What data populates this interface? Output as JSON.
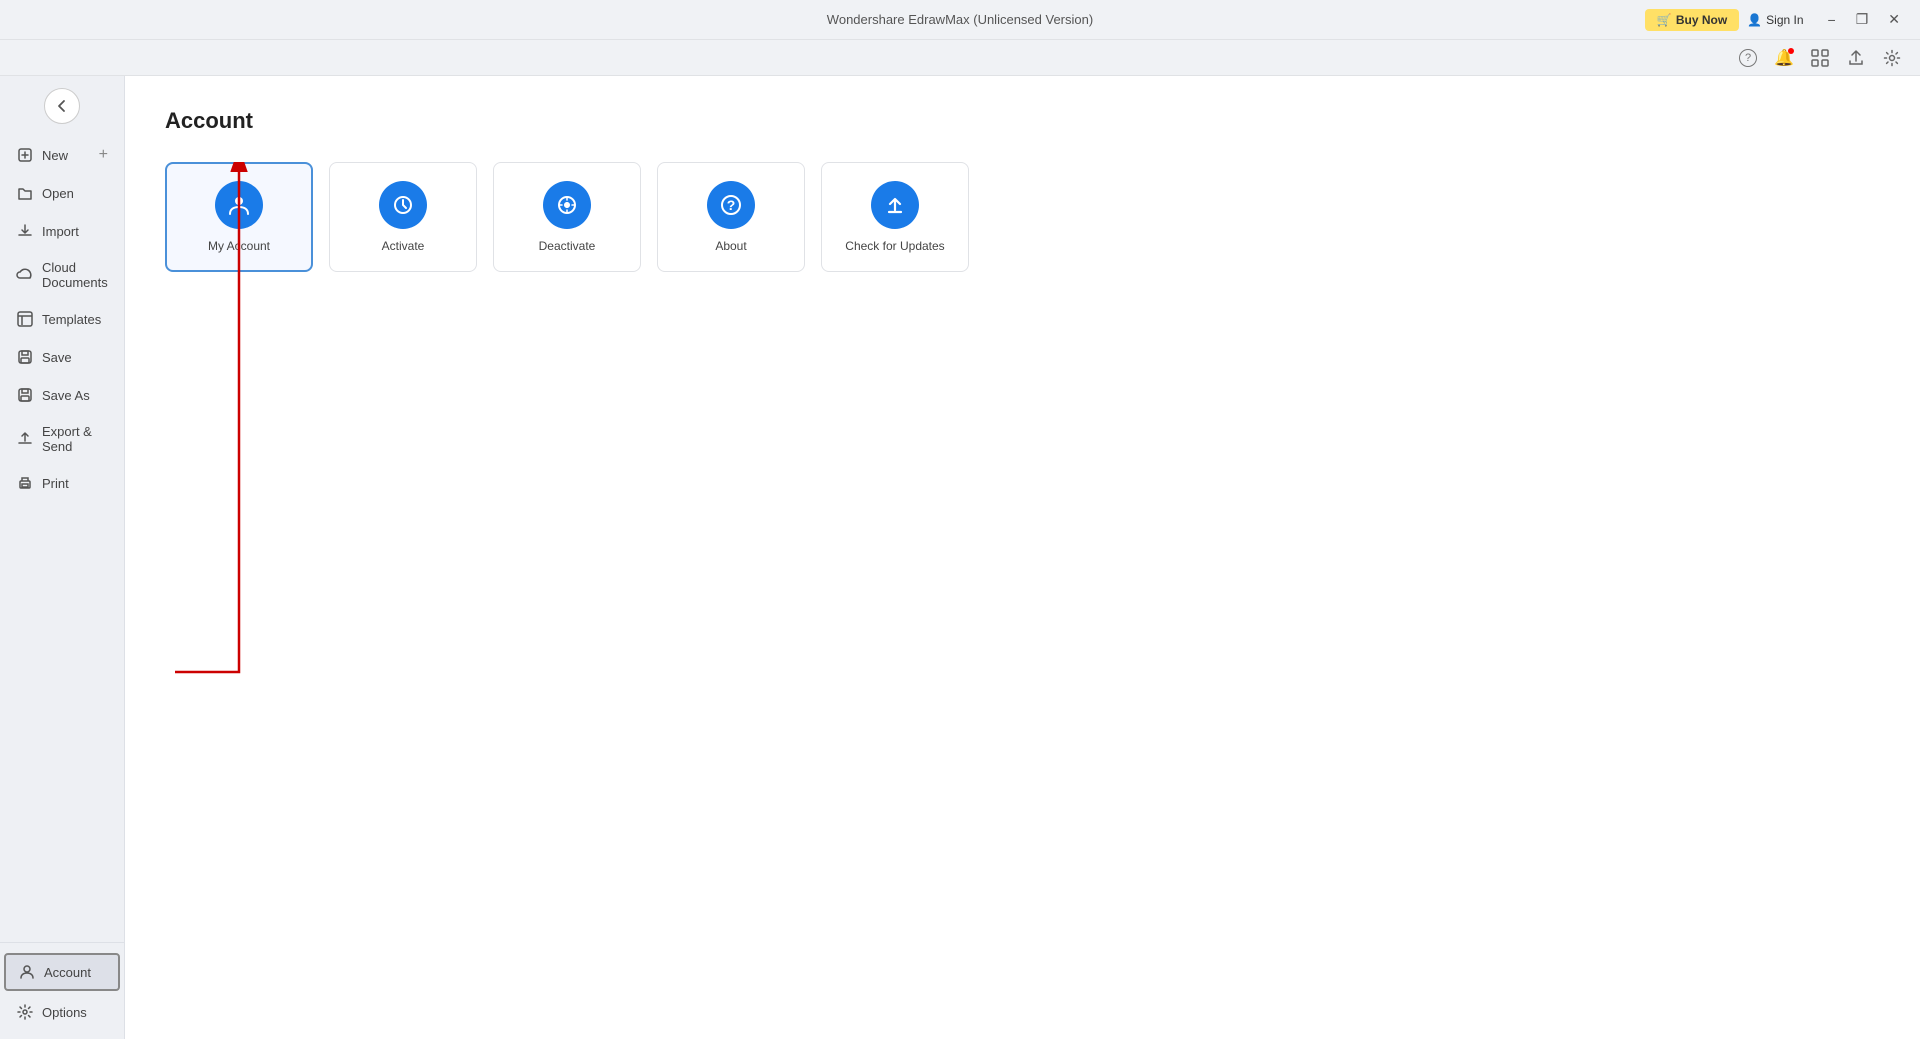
{
  "titlebar": {
    "title": "Wondershare EdrawMax (Unlicensed Version)",
    "buy_now": "Buy Now",
    "sign_in": "Sign In",
    "minimize": "−",
    "restore": "❐",
    "close": "✕"
  },
  "sidebar": {
    "new_label": "New",
    "new_plus": "+",
    "items": [
      {
        "id": "open",
        "label": "Open",
        "icon": "📂"
      },
      {
        "id": "import",
        "label": "Import",
        "icon": "📥"
      },
      {
        "id": "cloud",
        "label": "Cloud Documents",
        "icon": "☁"
      },
      {
        "id": "templates",
        "label": "Templates",
        "icon": "📄"
      },
      {
        "id": "save",
        "label": "Save",
        "icon": "💾"
      },
      {
        "id": "saveas",
        "label": "Save As",
        "icon": "💾"
      },
      {
        "id": "export",
        "label": "Export & Send",
        "icon": "📤"
      },
      {
        "id": "print",
        "label": "Print",
        "icon": "🖨"
      }
    ],
    "bottom": [
      {
        "id": "account",
        "label": "Account",
        "icon": "👤",
        "active": true
      },
      {
        "id": "options",
        "label": "Options",
        "icon": "⚙"
      }
    ]
  },
  "content": {
    "page_title": "Account",
    "cards": [
      {
        "id": "my-account",
        "label": "My Account",
        "icon": "👤",
        "selected": true
      },
      {
        "id": "activate",
        "label": "Activate",
        "icon": "⚡"
      },
      {
        "id": "deactivate",
        "label": "Deactivate",
        "icon": "🔄"
      },
      {
        "id": "about",
        "label": "About",
        "icon": "?"
      },
      {
        "id": "check-updates",
        "label": "Check for Updates",
        "icon": "↑"
      }
    ]
  },
  "topicons": [
    {
      "id": "help",
      "icon": "?",
      "badge": false
    },
    {
      "id": "notification",
      "icon": "🔔",
      "badge": true
    },
    {
      "id": "grid",
      "icon": "⊞",
      "badge": false
    },
    {
      "id": "share",
      "icon": "↑",
      "badge": false
    },
    {
      "id": "settings",
      "icon": "⚙",
      "badge": false
    }
  ]
}
